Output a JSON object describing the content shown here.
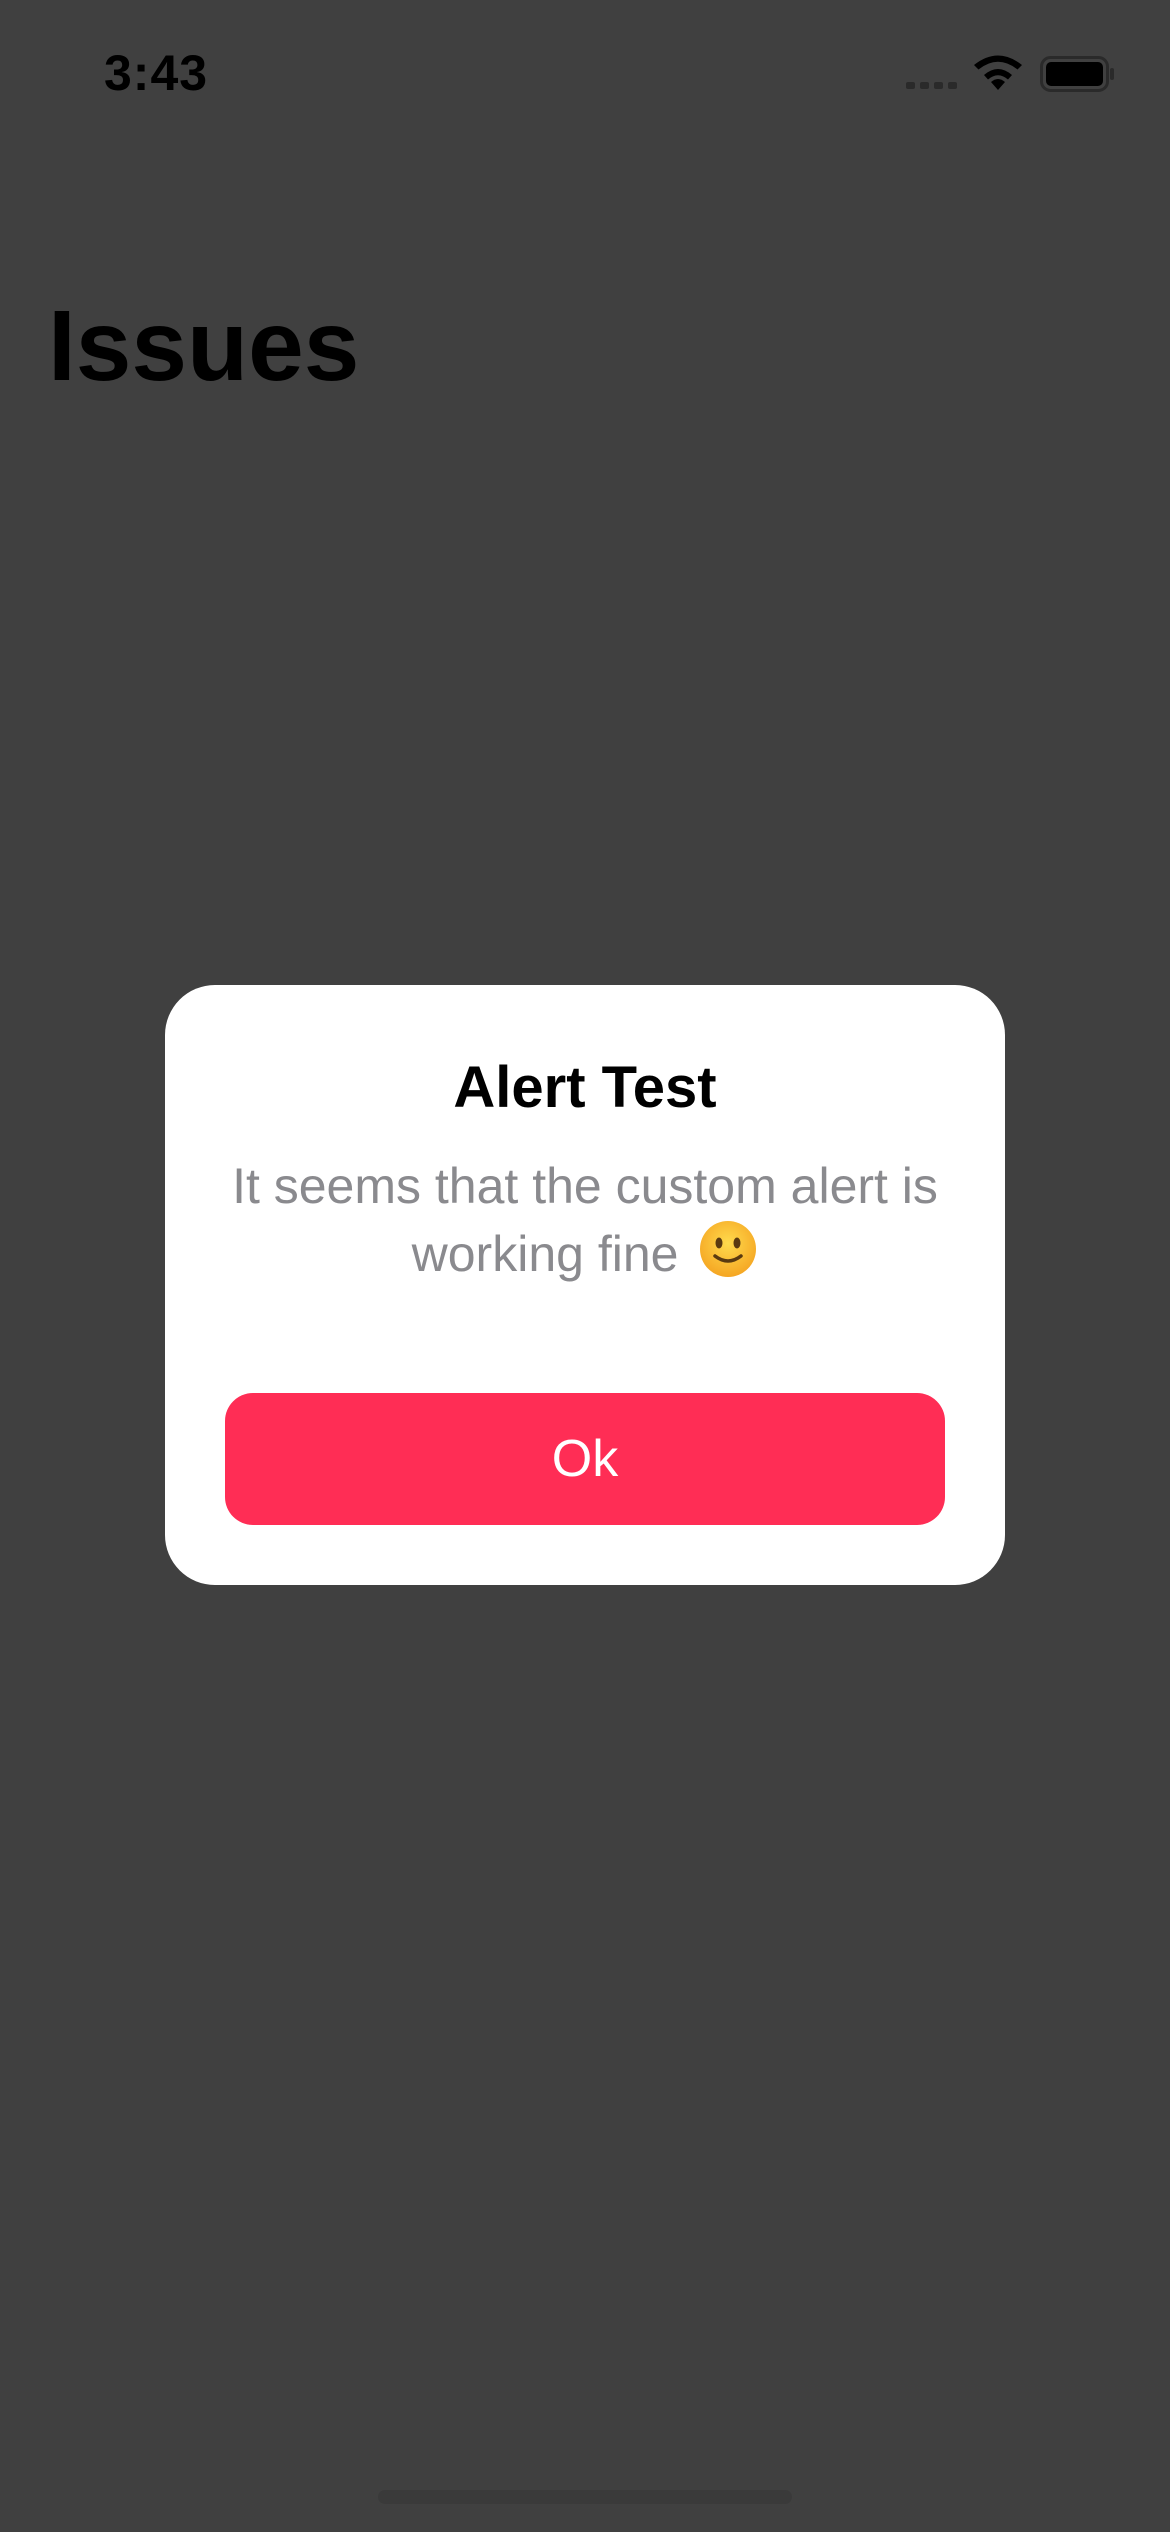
{
  "status_bar": {
    "time": "3:43",
    "icons": [
      "signal-icon",
      "wifi-icon",
      "battery-icon"
    ]
  },
  "page": {
    "title": "Issues"
  },
  "alert": {
    "title": "Alert Test",
    "message": "It seems that the custom alert is working fine",
    "emoji": "slightly-smiling-face-icon",
    "button_label": "Ok"
  },
  "colors": {
    "overlay": "#404040",
    "card": "#ffffff",
    "button": "#ff2d55",
    "message_text": "#8a8a8e"
  }
}
